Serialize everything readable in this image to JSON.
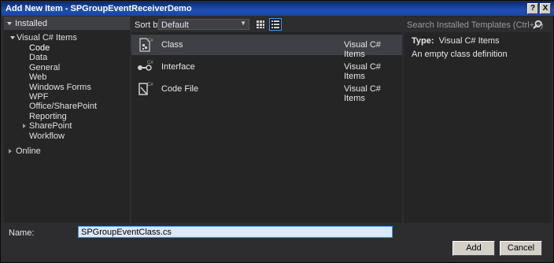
{
  "window": {
    "title": "Add New Item - SPGroupEventReceiverDemo"
  },
  "titlebar_buttons": {
    "help": "?",
    "close": "X"
  },
  "left_panel": {
    "installed_label": "Installed",
    "tree": [
      {
        "label": "Visual C# Items"
      },
      {
        "label": "Code"
      },
      {
        "label": "Data"
      },
      {
        "label": "General"
      },
      {
        "label": "Web"
      },
      {
        "label": "Windows Forms"
      },
      {
        "label": "WPF"
      },
      {
        "label": "Office/SharePoint"
      },
      {
        "label": "Reporting"
      },
      {
        "label": "SharePoint"
      },
      {
        "label": "Workflow"
      },
      {
        "label": "Online"
      }
    ],
    "selected": "Code"
  },
  "toolbar": {
    "sort_label": "Sort by:",
    "sort_value": "Default",
    "views": [
      "grid-view-icon",
      "list-view-icon"
    ]
  },
  "templates": [
    {
      "name": "Class",
      "language": "Visual C# Items",
      "icon": "class-file-icon",
      "selected": true
    },
    {
      "name": "Interface",
      "language": "Visual C# Items",
      "icon": "interface-icon",
      "selected": false
    },
    {
      "name": "Code File",
      "language": "Visual C# Items",
      "icon": "code-file-icon",
      "selected": false
    }
  ],
  "search": {
    "placeholder": "Search Installed Templates (Ctrl+E)",
    "icon": "search-icon"
  },
  "details": {
    "type_label": "Type:",
    "type_value": "Visual C# Items",
    "description": "An empty class definition"
  },
  "name_field": {
    "label": "Name:",
    "value": "SPGroupEventClass.cs"
  },
  "buttons": {
    "add": "Add",
    "cancel": "Cancel"
  },
  "colors": {
    "background": "#2d2d30",
    "panel": "#252526",
    "selection": "#3f3f46",
    "accent": "#3399ff",
    "titlebar": "#1e4fb3"
  }
}
